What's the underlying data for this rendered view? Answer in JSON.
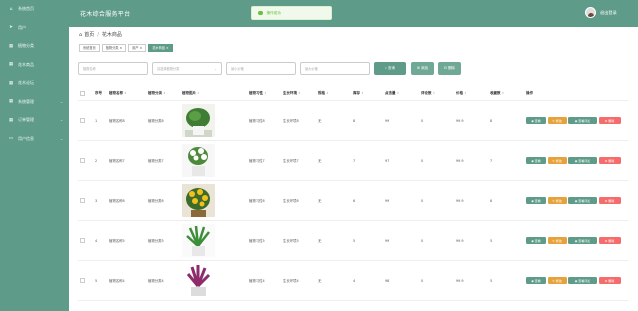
{
  "app": {
    "title": "花木综合服务平台",
    "logout": "退出登录"
  },
  "toast": {
    "message": "操作成功"
  },
  "sidebar": {
    "items": [
      {
        "label": "系统首页",
        "icon": "home-icon",
        "glyph": "⌂",
        "arrow": ""
      },
      {
        "label": "用户",
        "icon": "send-icon",
        "glyph": "➤",
        "arrow": ""
      },
      {
        "label": "植物分类",
        "icon": "grid-icon",
        "glyph": "▦",
        "arrow": ""
      },
      {
        "label": "花木商品",
        "icon": "grid-icon",
        "glyph": "▦",
        "arrow": ""
      },
      {
        "label": "花木论坛",
        "icon": "grid-icon",
        "glyph": "▦",
        "arrow": ""
      },
      {
        "label": "系统管理",
        "icon": "grid-icon",
        "glyph": "▦",
        "arrow": "⌄"
      },
      {
        "label": "订单管理",
        "icon": "grid-icon",
        "glyph": "▦",
        "arrow": "⌄"
      },
      {
        "label": "用户信息",
        "icon": "card-icon",
        "glyph": "▭",
        "arrow": "⌄"
      }
    ]
  },
  "breadcrumb": {
    "home": "首页",
    "separator": "/",
    "current": "花木商品"
  },
  "tags": [
    "系统首页",
    "植物分类 ×",
    "用户 ×",
    "花木商品 ×"
  ],
  "filters": {
    "name_placeholder": "植物名称",
    "category_placeholder": "请选择植物分类",
    "price_min_placeholder": "最小价格",
    "price_max_placeholder": "最大价格",
    "search": "⌕ 查询",
    "add": "⊞ 添加",
    "delete": "⊟ 删除"
  },
  "table": {
    "columns": [
      "序号",
      "植物名称",
      "植物分类",
      "植物图片",
      "植物习性",
      "生长环境",
      "规格",
      "库存",
      "点击量",
      "评论数",
      "价格",
      "收藏数",
      "操作"
    ],
    "sort_arrows": "⇕",
    "actions": {
      "view": "◉ 查看",
      "edit": "✎ 修改",
      "reviews": "◉ 查看评论",
      "delete": "⊗ 删除"
    },
    "rows": [
      {
        "index": "1",
        "name": "植物名称8",
        "category": "植物分类8",
        "habit": "植物习性8",
        "env": "生长环境8",
        "spec": "无",
        "stock": "8",
        "clicks": "99",
        "comments": "0",
        "price": "99.9",
        "favorites": "8",
        "flower": "green"
      },
      {
        "index": "2",
        "name": "植物名称7",
        "category": "植物分类7",
        "habit": "植物习性7",
        "env": "生长环境7",
        "spec": "无",
        "stock": "7",
        "clicks": "97",
        "comments": "0",
        "price": "99.9",
        "favorites": "7",
        "flower": "white"
      },
      {
        "index": "3",
        "name": "植物名称6",
        "category": "植物分类6",
        "habit": "植物习性6",
        "env": "生长环境6",
        "spec": "无",
        "stock": "6",
        "clicks": "99",
        "comments": "0",
        "price": "99.9",
        "favorites": "6",
        "flower": "yellow"
      },
      {
        "index": "4",
        "name": "植物名称5",
        "category": "植物分类5",
        "habit": "植物习性5",
        "env": "生长环境5",
        "spec": "无",
        "stock": "5",
        "clicks": "99",
        "comments": "0",
        "price": "99.9",
        "favorites": "5",
        "flower": "fern"
      },
      {
        "index": "5",
        "name": "植物名称4",
        "category": "植物分类4",
        "habit": "植物习性4",
        "env": "生长环境4",
        "spec": "无",
        "stock": "4",
        "clicks": "98",
        "comments": "0",
        "price": "99.9",
        "favorites": "5",
        "flower": "purple"
      }
    ]
  },
  "colors": {
    "accent": "#5e9b88",
    "edit": "#e6a23c",
    "delete": "#f56c6c",
    "success": "#67c23a"
  }
}
